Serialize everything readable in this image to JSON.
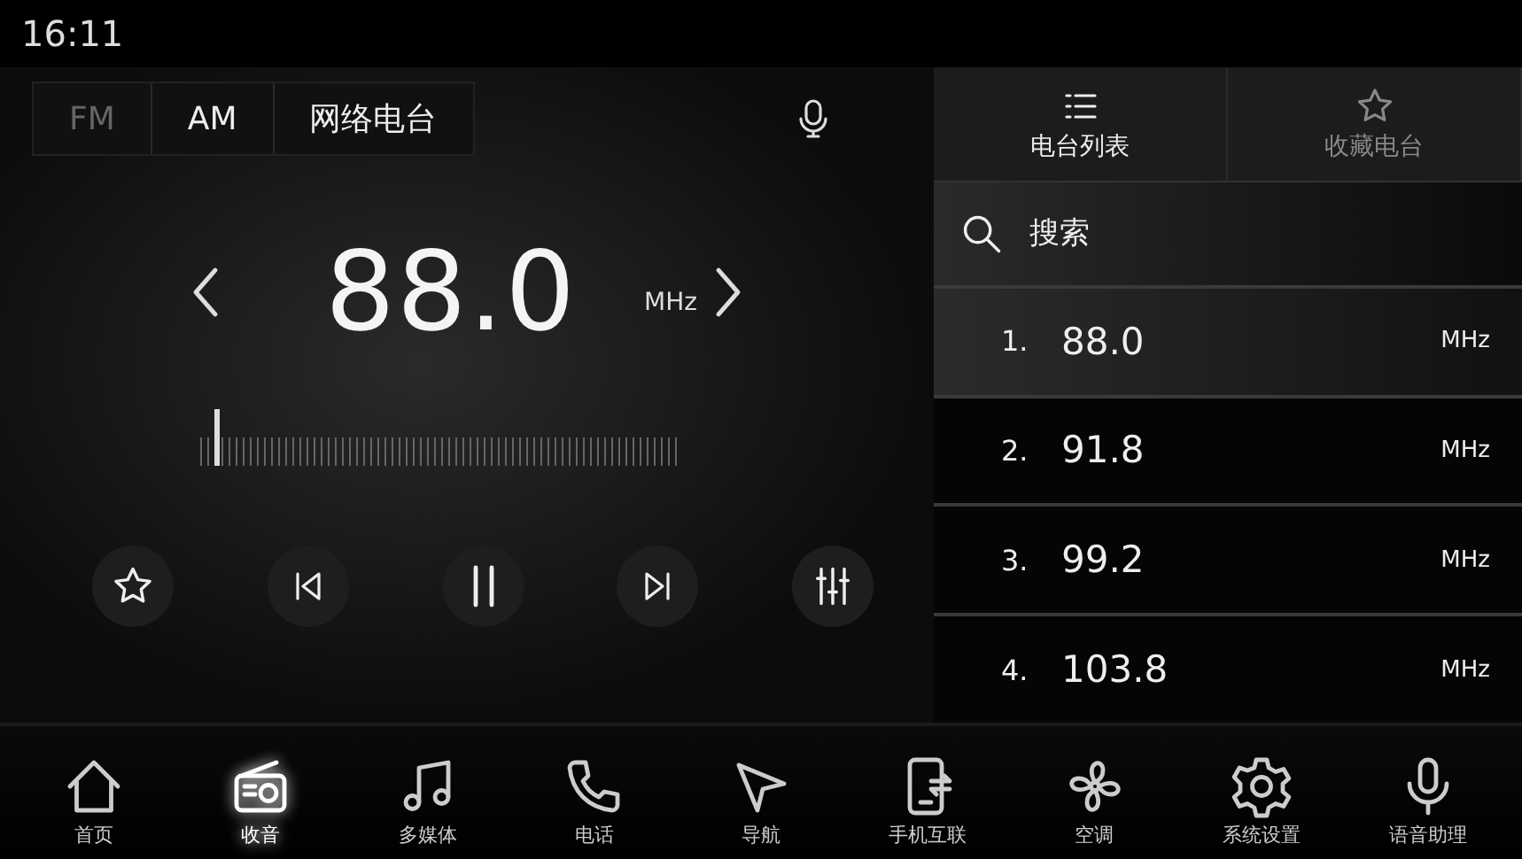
{
  "status_bar": {
    "time": "16:11"
  },
  "bands": [
    {
      "label": "FM",
      "selected": true
    },
    {
      "label": "AM",
      "selected": false
    },
    {
      "label": "网络电台",
      "selected": false
    }
  ],
  "frequency": {
    "value": "88.0",
    "unit": "MHz"
  },
  "tuner": {
    "level": 0.03
  },
  "panel_tabs": [
    {
      "label": "电台列表",
      "selected": true
    },
    {
      "label": "收藏电台",
      "selected": false
    }
  ],
  "search": {
    "placeholder": "搜索"
  },
  "stations": [
    {
      "index": "1.",
      "frequency": "88.0",
      "unit": "MHz",
      "selected": true
    },
    {
      "index": "2.",
      "frequency": "91.8",
      "unit": "MHz",
      "selected": false
    },
    {
      "index": "3.",
      "frequency": "99.2",
      "unit": "MHz",
      "selected": false
    },
    {
      "index": "4.",
      "frequency": "103.8",
      "unit": "MHz",
      "selected": false
    }
  ],
  "nav": [
    {
      "label": "首页",
      "selected": false
    },
    {
      "label": "收音",
      "selected": true
    },
    {
      "label": "多媒体",
      "selected": false
    },
    {
      "label": "电话",
      "selected": false
    },
    {
      "label": "导航",
      "selected": false
    },
    {
      "label": "手机互联",
      "selected": false
    },
    {
      "label": "空调",
      "selected": false
    },
    {
      "label": "系统设置",
      "selected": false
    },
    {
      "label": "语音助理",
      "selected": false
    }
  ]
}
